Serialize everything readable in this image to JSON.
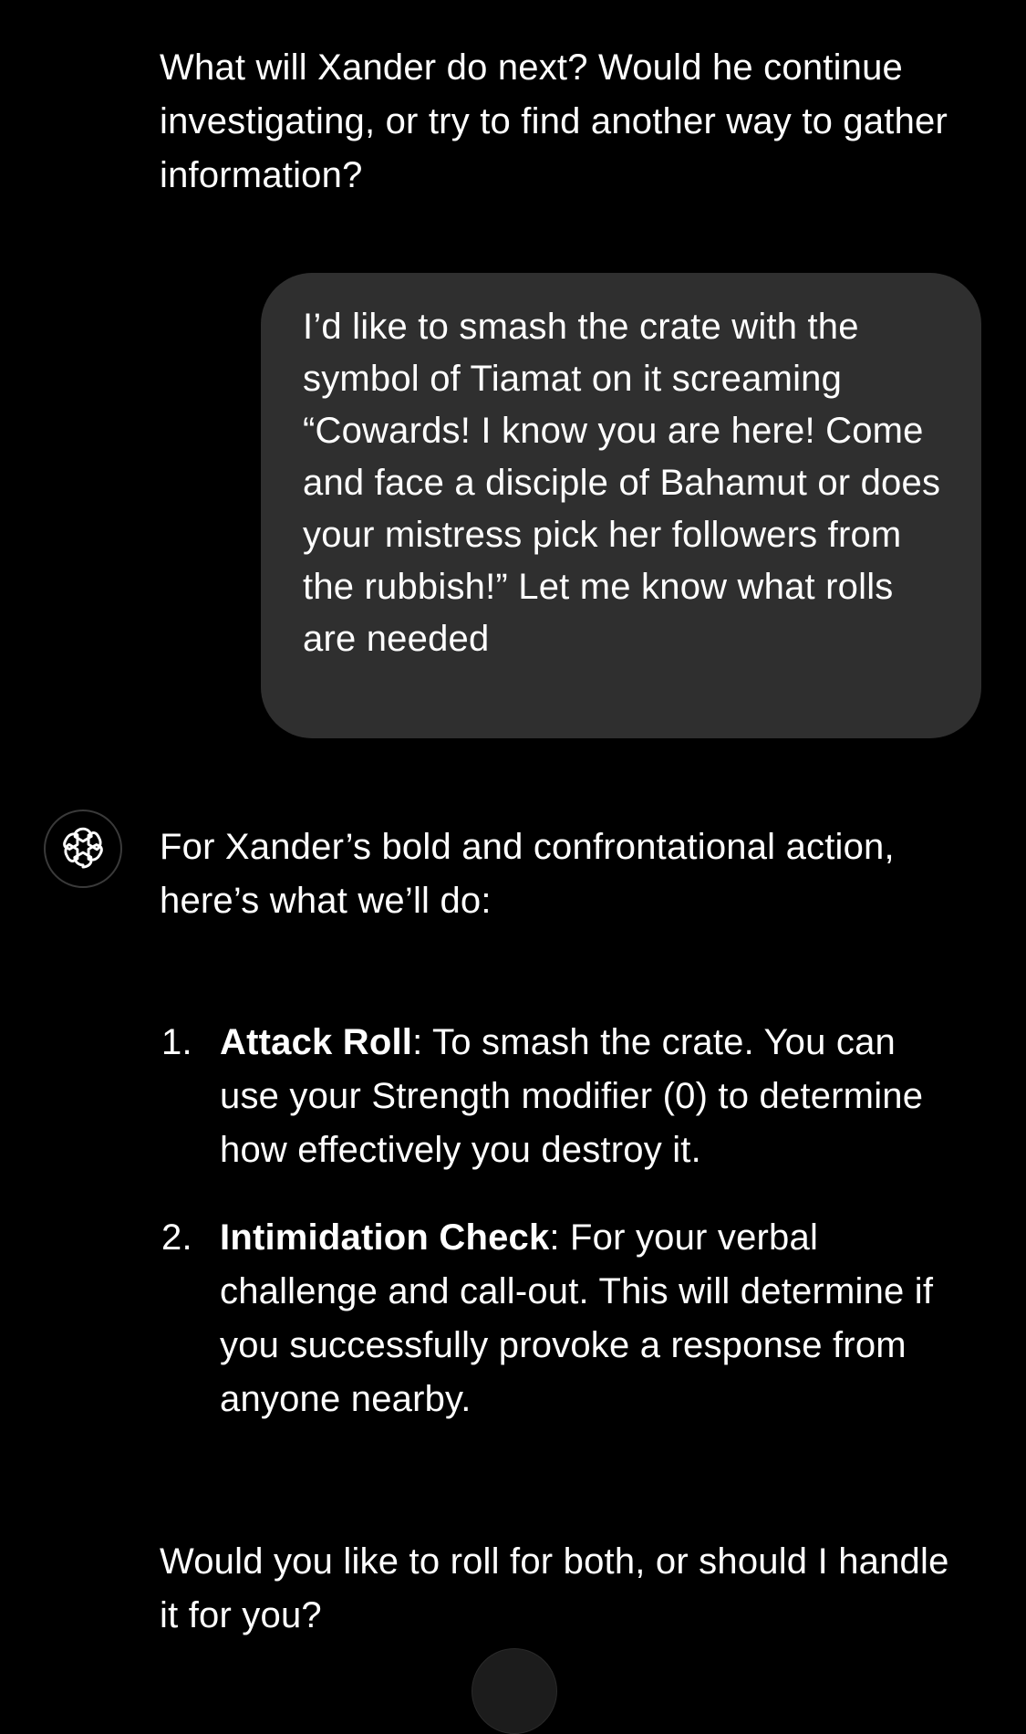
{
  "conversation": {
    "assistant_previous": {
      "text": "What will Xander do next? Would he continue investigating, or try to find another way to gather information?"
    },
    "user_message": {
      "text": "I’d like to smash the crate with the symbol of Tiamat on it screaming “Cowards! I know you are here! Come and face a disciple of Bahamut or does your mistress pick her followers from the rubbish!” Let me know what rolls are needed"
    },
    "assistant_reply": {
      "avatar_icon": "openai-logo-icon",
      "intro": "For Xander’s bold and confrontational action, here’s what we’ll do:",
      "steps": [
        {
          "number": "1.",
          "title": "Attack Roll",
          "text": ": To smash the crate. You can use your Strength modifier (0) to determine how effectively you destroy it."
        },
        {
          "number": "2.",
          "title": "Intimidation Check",
          "text": ": For your verbal challenge and call-out. This will determine if you successfully provoke a response from anyone nearby."
        }
      ],
      "question": "Would you like to roll for both, or should I handle it for you?"
    }
  },
  "colors": {
    "background": "#000000",
    "text": "#ffffff",
    "user_bubble": "#2f2f2f"
  }
}
